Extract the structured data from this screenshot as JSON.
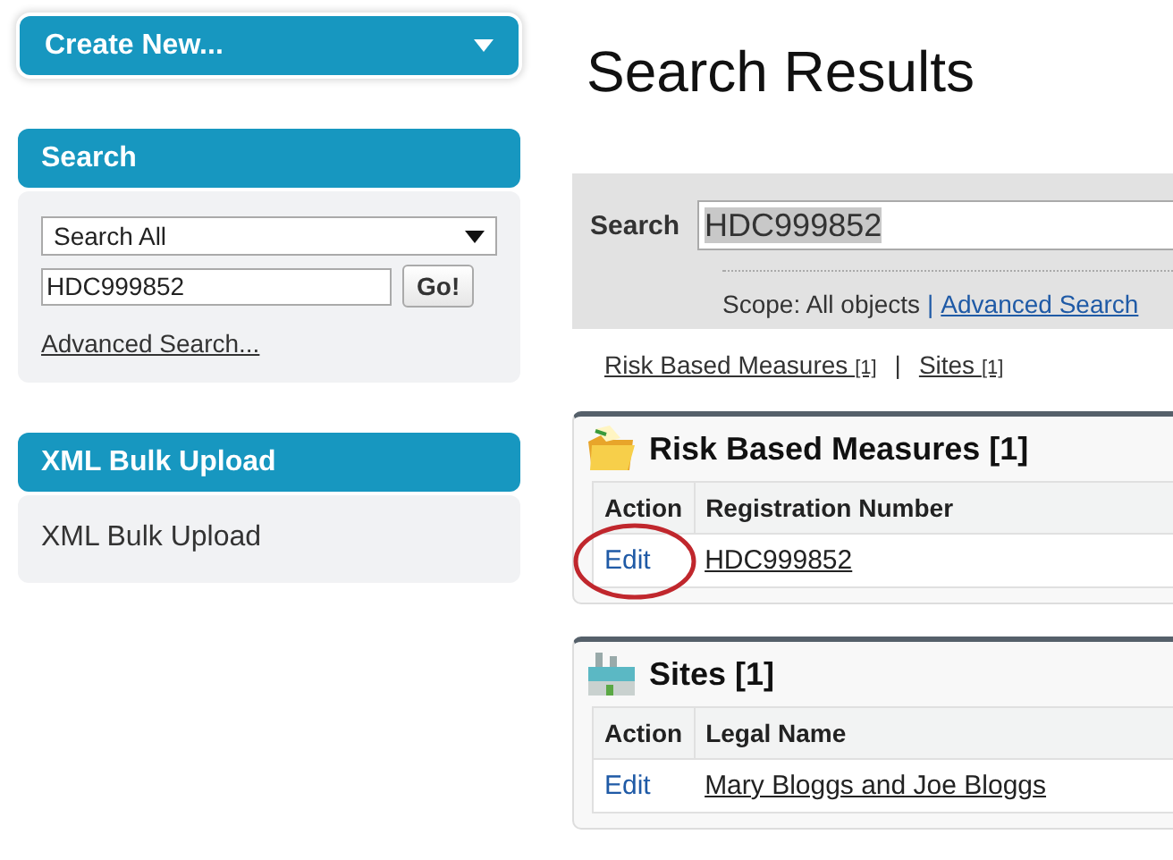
{
  "create_new": {
    "label": "Create New..."
  },
  "sidebar": {
    "search": {
      "title": "Search",
      "scope": "Search All",
      "query": "HDC999852",
      "go": "Go!",
      "advanced_link": "Advanced Search..."
    },
    "xml_upload": {
      "title": "XML Bulk Upload",
      "link": "XML Bulk Upload"
    }
  },
  "page_title": "Search Results",
  "search_bar": {
    "label": "Search",
    "query": "HDC999852",
    "scope": "Scope: All objects",
    "separator": "|",
    "advanced_link": "Advanced Search"
  },
  "jump_links": {
    "separator": "|",
    "items": [
      {
        "label": "Risk Based Measures",
        "count": "[1]"
      },
      {
        "label": "Sites",
        "count": "[1]"
      }
    ]
  },
  "results": [
    {
      "title": "Risk Based Measures [1]",
      "kind": "folder",
      "columns": [
        "Action",
        "Registration Number"
      ],
      "rows": [
        {
          "action": "Edit",
          "value": "HDC999852",
          "circled": true
        }
      ]
    },
    {
      "title": "Sites [1]",
      "kind": "site",
      "columns": [
        "Action",
        "Legal Name"
      ],
      "rows": [
        {
          "action": "Edit",
          "value": "Mary Bloggs and Joe Bloggs",
          "circled": false
        }
      ]
    }
  ]
}
